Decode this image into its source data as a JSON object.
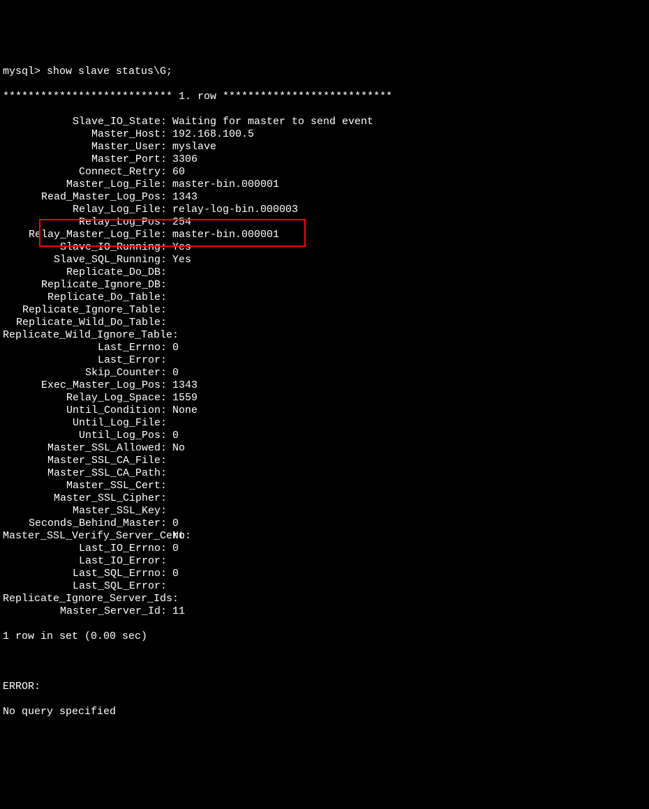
{
  "prompt": "mysql> show slave status\\G;",
  "row_header": "*************************** 1. row ***************************",
  "fields": [
    {
      "label": "Slave_IO_State",
      "value": "Waiting for master to send event"
    },
    {
      "label": "Master_Host",
      "value": "192.168.100.5"
    },
    {
      "label": "Master_User",
      "value": "myslave"
    },
    {
      "label": "Master_Port",
      "value": "3306"
    },
    {
      "label": "Connect_Retry",
      "value": "60"
    },
    {
      "label": "Master_Log_File",
      "value": "master-bin.000001"
    },
    {
      "label": "Read_Master_Log_Pos",
      "value": "1343"
    },
    {
      "label": "Relay_Log_File",
      "value": "relay-log-bin.000003"
    },
    {
      "label": "Relay_Log_Pos",
      "value": "254"
    },
    {
      "label": "Relay_Master_Log_File",
      "value": "master-bin.000001"
    },
    {
      "label": "Slave_IO_Running",
      "value": "Yes"
    },
    {
      "label": "Slave_SQL_Running",
      "value": "Yes"
    },
    {
      "label": "Replicate_Do_DB",
      "value": ""
    },
    {
      "label": "Replicate_Ignore_DB",
      "value": ""
    },
    {
      "label": "Replicate_Do_Table",
      "value": ""
    },
    {
      "label": "Replicate_Ignore_Table",
      "value": ""
    },
    {
      "label": "Replicate_Wild_Do_Table",
      "value": ""
    },
    {
      "label": "Replicate_Wild_Ignore_Table",
      "value": ""
    },
    {
      "label": "Last_Errno",
      "value": "0"
    },
    {
      "label": "Last_Error",
      "value": ""
    },
    {
      "label": "Skip_Counter",
      "value": "0"
    },
    {
      "label": "Exec_Master_Log_Pos",
      "value": "1343"
    },
    {
      "label": "Relay_Log_Space",
      "value": "1559"
    },
    {
      "label": "Until_Condition",
      "value": "None"
    },
    {
      "label": "Until_Log_File",
      "value": ""
    },
    {
      "label": "Until_Log_Pos",
      "value": "0"
    },
    {
      "label": "Master_SSL_Allowed",
      "value": "No"
    },
    {
      "label": "Master_SSL_CA_File",
      "value": ""
    },
    {
      "label": "Master_SSL_CA_Path",
      "value": ""
    },
    {
      "label": "Master_SSL_Cert",
      "value": ""
    },
    {
      "label": "Master_SSL_Cipher",
      "value": ""
    },
    {
      "label": "Master_SSL_Key",
      "value": ""
    },
    {
      "label": "Seconds_Behind_Master",
      "value": "0"
    },
    {
      "label": "Master_SSL_Verify_Server_Cert",
      "value": "No"
    },
    {
      "label": "Last_IO_Errno",
      "value": "0"
    },
    {
      "label": "Last_IO_Error",
      "value": ""
    },
    {
      "label": "Last_SQL_Errno",
      "value": "0"
    },
    {
      "label": "Last_SQL_Error",
      "value": ""
    },
    {
      "label": "Replicate_Ignore_Server_Ids",
      "value": ""
    },
    {
      "label": "Master_Server_Id",
      "value": "11"
    }
  ],
  "footer_rows": "1 row in set (0.00 sec)",
  "error_label": "ERROR:",
  "error_msg": "No query specified"
}
